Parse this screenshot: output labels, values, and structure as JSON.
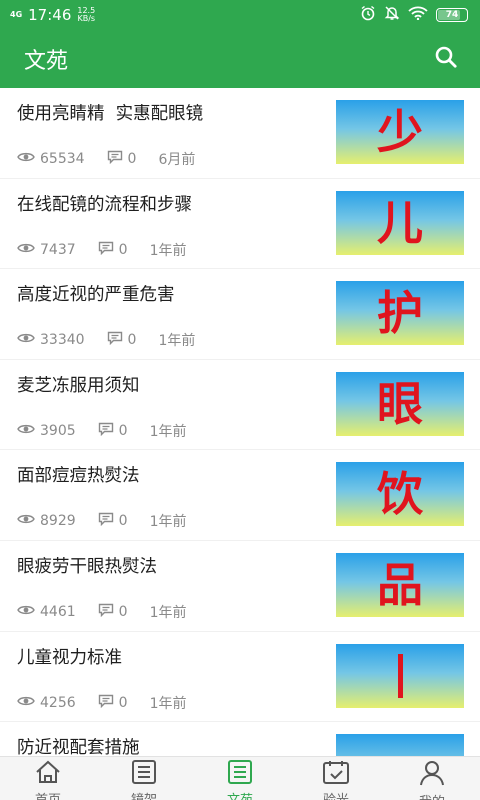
{
  "status_bar": {
    "network": "4G",
    "time": "17:46",
    "speed_value": "12.5",
    "speed_unit": "KB/s",
    "battery": "74"
  },
  "appbar": {
    "title": "文苑"
  },
  "articles": [
    {
      "title": "使用亮睛精  实惠配眼镜",
      "views": "65534",
      "comments": "0",
      "time": "6月前",
      "thumb": "少"
    },
    {
      "title": "在线配镜的流程和步骤",
      "views": "7437",
      "comments": "0",
      "time": "1年前",
      "thumb": "儿"
    },
    {
      "title": "高度近视的严重危害",
      "views": "33340",
      "comments": "0",
      "time": "1年前",
      "thumb": "护"
    },
    {
      "title": "麦芝冻服用须知",
      "views": "3905",
      "comments": "0",
      "time": "1年前",
      "thumb": "眼"
    },
    {
      "title": "面部痘痘热熨法",
      "views": "8929",
      "comments": "0",
      "time": "1年前",
      "thumb": "饮"
    },
    {
      "title": "眼疲劳干眼热熨法",
      "views": "4461",
      "comments": "0",
      "time": "1年前",
      "thumb": "品"
    },
    {
      "title": "儿童视力标准",
      "views": "4256",
      "comments": "0",
      "time": "1年前",
      "thumb": ""
    },
    {
      "title": "防近视配套措施",
      "views": "",
      "comments": "",
      "time": "",
      "thumb": ""
    }
  ],
  "tabs": [
    {
      "label": "首页",
      "icon": "home-icon"
    },
    {
      "label": "镜架",
      "icon": "list-icon"
    },
    {
      "label": "文苑",
      "icon": "article-icon"
    },
    {
      "label": "验光",
      "icon": "calendar-icon"
    },
    {
      "label": "我的",
      "icon": "user-icon"
    }
  ],
  "colors": {
    "primary": "#2fa84f",
    "thumb_text": "#e0141e",
    "meta": "#8a8a8a"
  }
}
